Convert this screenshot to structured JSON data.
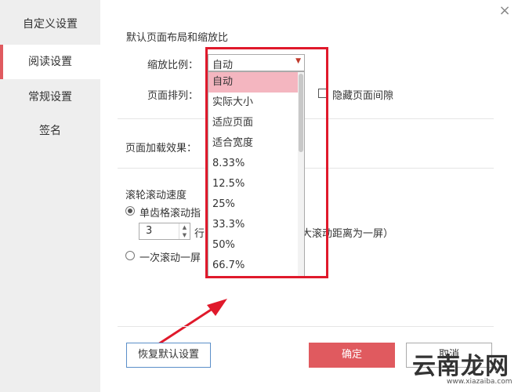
{
  "sidebar": {
    "title": "自定义设置",
    "items": [
      {
        "label": "阅读设置",
        "active": true
      },
      {
        "label": "常规设置",
        "active": false
      },
      {
        "label": "签名",
        "active": false
      }
    ]
  },
  "window": {
    "close_icon": "×"
  },
  "layout_section": {
    "heading": "默认页面布局和缩放比",
    "zoom_label": "缩放比例：",
    "zoom_value": "自动",
    "arrange_label": "页面排列：",
    "hide_gap_label": "隐藏页面间隙"
  },
  "zoom_dropdown": {
    "options": [
      "自动",
      "实际大小",
      "适应页面",
      "适合宽度",
      "8.33%",
      "12.5%",
      "25%",
      "33.3%",
      "50%",
      "66.7%"
    ],
    "selected_index": 0
  },
  "load_section": {
    "label": "页面加载效果："
  },
  "scroll_section": {
    "heading": "滚轮滚动速度",
    "option_single_label": "单齿格滚动指",
    "line_count": "3",
    "line_prefix": "行",
    "line_suffix": "最大滚动距离为一屏）",
    "option_page_label": "一次滚动一屏"
  },
  "buttons": {
    "restore_label": "恢复默认设置",
    "ok_label": "确定",
    "cancel_label": "取消"
  },
  "watermark": {
    "text": "云南龙网",
    "url": "www.xiazaiba.com"
  },
  "colors": {
    "accent": "#e05a5f",
    "highlight": "#e0192b",
    "selected_option": "#f4b6c0"
  }
}
